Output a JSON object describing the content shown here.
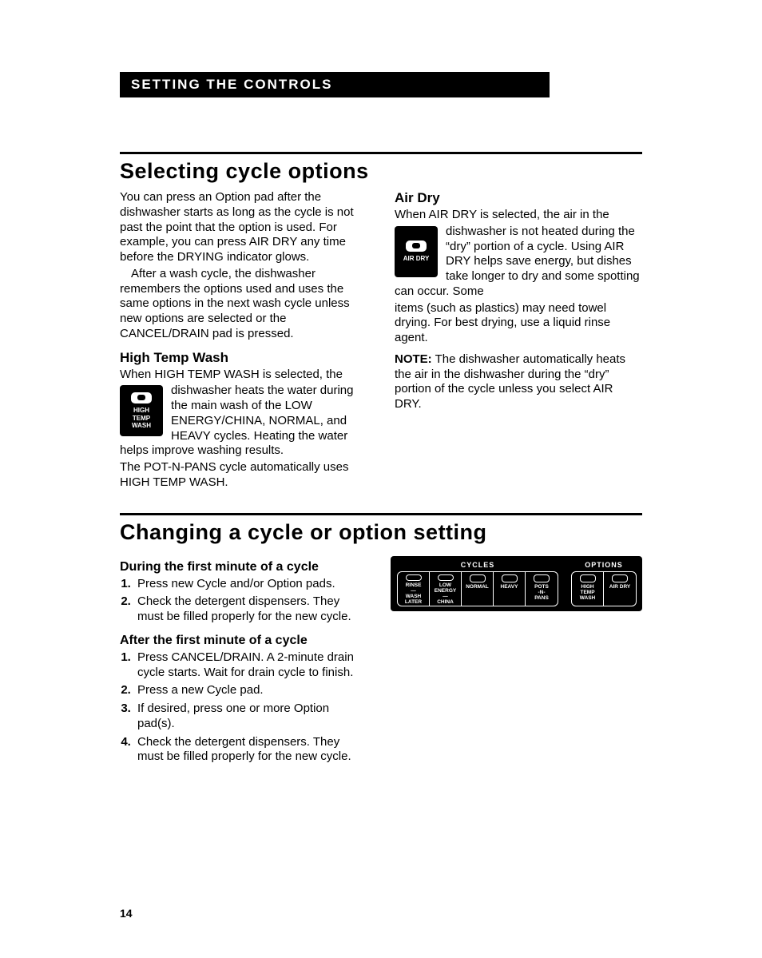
{
  "header": "SETTING THE CONTROLS",
  "section1": {
    "title": "Selecting cycle options",
    "intro1": "You can press an Option pad after the dishwasher starts as long as the cycle is not past the point that the option is used. For example, you can press AIR DRY any time before the DRYING indicator glows.",
    "intro2": "After a wash cycle, the dishwasher remembers the options used and uses the same options in the next wash cycle unless new options are selected or the CANCEL/DRAIN pad is pressed.",
    "htw": {
      "heading": "High Temp Wash",
      "lead": "When HIGH TEMP WASH is selected, the",
      "pad_label": "HIGH\nTEMP\nWASH",
      "wrap": "dishwasher heats the water during the main wash of the LOW ENERGY/CHINA, NORMAL, and HEAVY cycles. Heating the water helps improve washing results.",
      "tail": "The POT-N-PANS cycle automatically uses HIGH TEMP WASH."
    },
    "airdry": {
      "heading": "Air Dry",
      "lead": "When AIR DRY is selected, the air in the",
      "pad_label": "AIR DRY",
      "wrap": "dishwasher is not heated during the “dry” portion of a cycle. Using AIR DRY helps save energy, but dishes take longer to dry and some spotting can occur. Some",
      "tail": "items (such as plastics) may need towel drying. For best drying, use a liquid rinse agent.",
      "note_label": "NOTE:",
      "note_text": " The dishwasher automatically heats the air in the dishwasher during the “dry” portion of the cycle unless you select AIR DRY."
    }
  },
  "section2": {
    "title": "Changing a cycle or option setting",
    "sub1": {
      "heading": "During the first minute of a cycle",
      "items": [
        "Press new Cycle and/or Option pads.",
        "Check the detergent dispensers. They must be filled properly for the new cycle."
      ]
    },
    "sub2": {
      "heading": "After the first minute of a cycle",
      "items": [
        "Press CANCEL/DRAIN. A 2-minute drain cycle starts. Wait for drain cycle to finish.",
        "Press a new Cycle pad.",
        "If desired, press one or more Option pad(s).",
        "Check the detergent dispensers. They must be filled properly for the new cycle."
      ]
    },
    "panel": {
      "groups": [
        {
          "head": "CYCLES",
          "buttons": [
            "RINSE\n—\nWASH\nLATER",
            "LOW\nENERGY\n—\nCHINA",
            "NORMAL",
            "HEAVY",
            "POTS\n-N-\nPANS"
          ]
        },
        {
          "head": "OPTIONS",
          "buttons": [
            "HIGH\nTEMP\nWASH",
            "AIR DRY"
          ]
        }
      ]
    }
  },
  "page_number": "14"
}
